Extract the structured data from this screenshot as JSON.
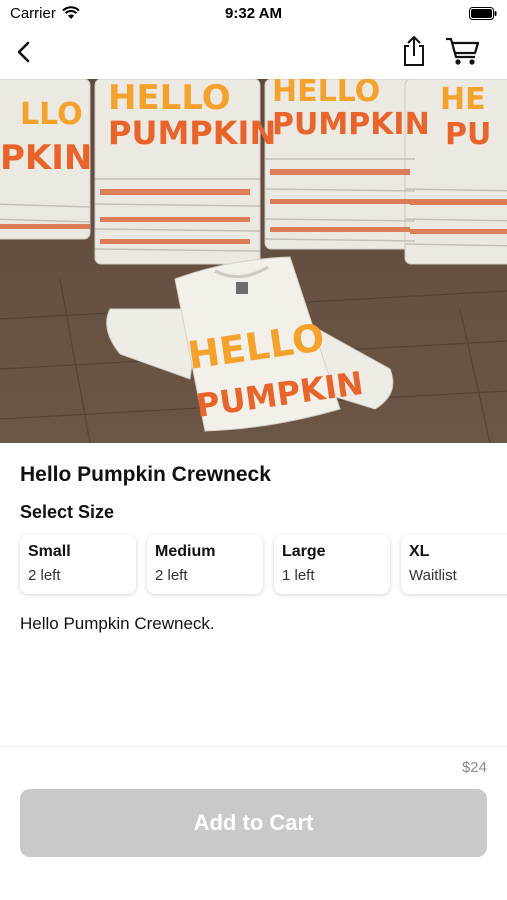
{
  "status_bar": {
    "carrier": "Carrier",
    "time": "9:32 AM"
  },
  "nav": {
    "icons": [
      "back-chevron-icon",
      "share-icon",
      "cart-icon"
    ]
  },
  "hero": {
    "description": "photo",
    "shirt_text_top": "HELLO",
    "shirt_text_bottom": "PUMPKIN"
  },
  "product": {
    "title": "Hello Pumpkin Crewneck",
    "select_size_label": "Select Size",
    "sizes": [
      {
        "name": "Small",
        "stock": "2 left"
      },
      {
        "name": "Medium",
        "stock": "2 left"
      },
      {
        "name": "Large",
        "stock": "1 left"
      },
      {
        "name": "XL",
        "stock": "Waitlist"
      }
    ],
    "description": "Hello Pumpkin Crewneck."
  },
  "footer": {
    "price": "$24",
    "add_to_cart_label": "Add to Cart"
  },
  "colors": {
    "button_disabled": "#c9c9c9",
    "price_gray": "#8a8a8a",
    "shirt_orange": "#e8642a",
    "shirt_yellow": "#f4a22c"
  }
}
